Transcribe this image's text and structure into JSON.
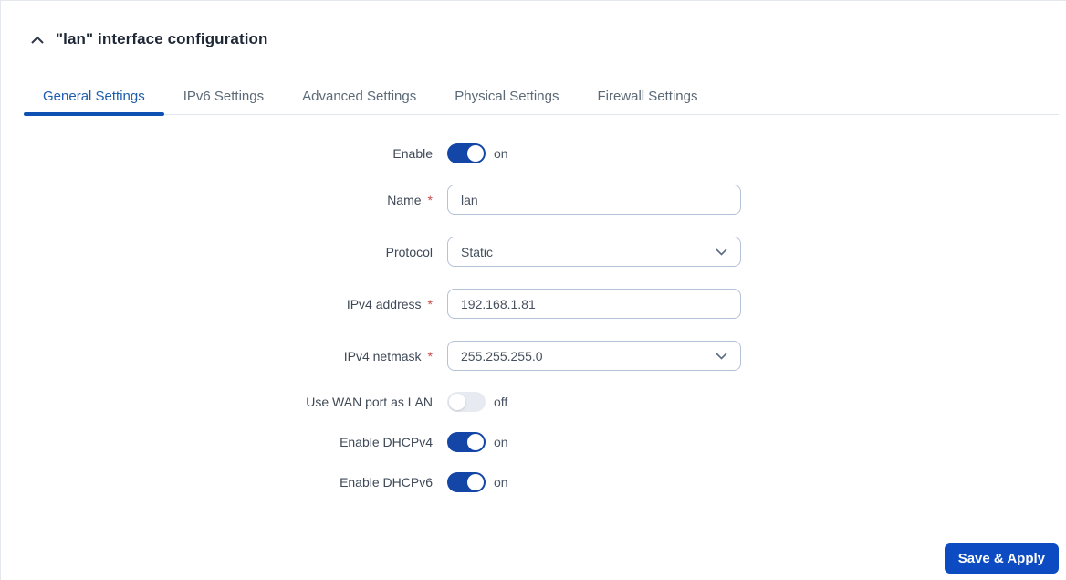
{
  "panel": {
    "title": "\"lan\" interface configuration"
  },
  "tabs": [
    {
      "label": "General Settings",
      "active": true
    },
    {
      "label": "IPv6 Settings",
      "active": false
    },
    {
      "label": "Advanced Settings",
      "active": false
    },
    {
      "label": "Physical Settings",
      "active": false
    },
    {
      "label": "Firewall Settings",
      "active": false
    }
  ],
  "form": {
    "fields": [
      {
        "label": "Enable",
        "type": "toggle",
        "state": "on"
      },
      {
        "label": "Name",
        "required_mark": "*",
        "type": "text",
        "value": "lan"
      },
      {
        "label": "Protocol",
        "type": "select",
        "value": "Static"
      },
      {
        "label": "IPv4 address",
        "required_mark": "*",
        "type": "text",
        "value": "192.168.1.81"
      },
      {
        "label": "IPv4 netmask",
        "required_mark": "*",
        "type": "select",
        "value": "255.255.255.0"
      },
      {
        "label": "Use WAN port as LAN",
        "type": "toggle",
        "state": "off"
      },
      {
        "label": "Enable DHCPv4",
        "type": "toggle",
        "state": "on"
      },
      {
        "label": "Enable DHCPv6",
        "type": "toggle",
        "state": "on"
      }
    ]
  },
  "actions": {
    "save_apply_label": "Save & Apply"
  },
  "colors": {
    "accent_blue": "#1346a6",
    "tab_active_text": "#1b5dad",
    "tab_underline": "#0d51b3",
    "button_blue": "#0c4bc2",
    "toggle_off_bg": "#e7eaf0",
    "required_red": "#cb4842",
    "border_gray": "#dfe5ec"
  }
}
